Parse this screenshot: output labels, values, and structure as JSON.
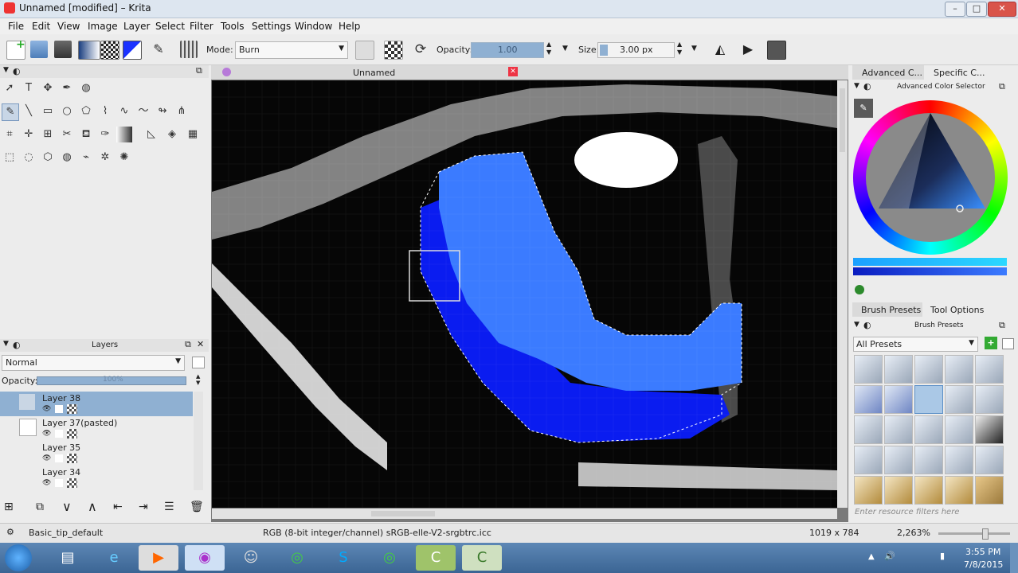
{
  "window": {
    "title": "Unnamed [modified] – Krita"
  },
  "menu": [
    "File",
    "Edit",
    "View",
    "Image",
    "Layer",
    "Select",
    "Filter",
    "Tools",
    "Settings",
    "Window",
    "Help"
  ],
  "toolbar": {
    "mode_label": "Mode:",
    "mode_value": "Burn",
    "opacity_label": "Opacity:",
    "opacity_value": "1.00",
    "size_label": "Size:",
    "size_value": "3.00 px"
  },
  "canvas": {
    "tab_title": "Unnamed"
  },
  "layers": {
    "title": "Layers",
    "blend_mode": "Normal",
    "opacity_label": "Opacity:",
    "opacity_value": "100%",
    "items": [
      {
        "name": "Layer 38",
        "selected": true
      },
      {
        "name": "Layer 37(pasted)",
        "selected": false
      },
      {
        "name": "Layer 35",
        "selected": false
      },
      {
        "name": "Layer 34",
        "selected": false
      }
    ]
  },
  "right": {
    "tab_advanced": "Advanced C...",
    "tab_specific": "Specific C...",
    "color_selector_title": "Advanced Color Selector",
    "tab_brush_presets": "Brush Presets",
    "tab_tool_options": "Tool Options",
    "brush_presets_title": "Brush Presets",
    "preset_filter": "All Presets",
    "filter_placeholder": "Enter resource filters here"
  },
  "status": {
    "brush": "Basic_tip_default",
    "color_space": "RGB (8-bit integer/channel)  sRGB-elle-V2-srgbtrc.icc",
    "dimensions": "1019 x 784",
    "zoom": "2,263%"
  },
  "taskbar": {
    "time": "3:55 PM",
    "date": "7/8/2015"
  },
  "colors": {
    "selection_blue": "#3b7bff",
    "deep_blue": "#0019ff",
    "accent": "#5b8fc6"
  }
}
